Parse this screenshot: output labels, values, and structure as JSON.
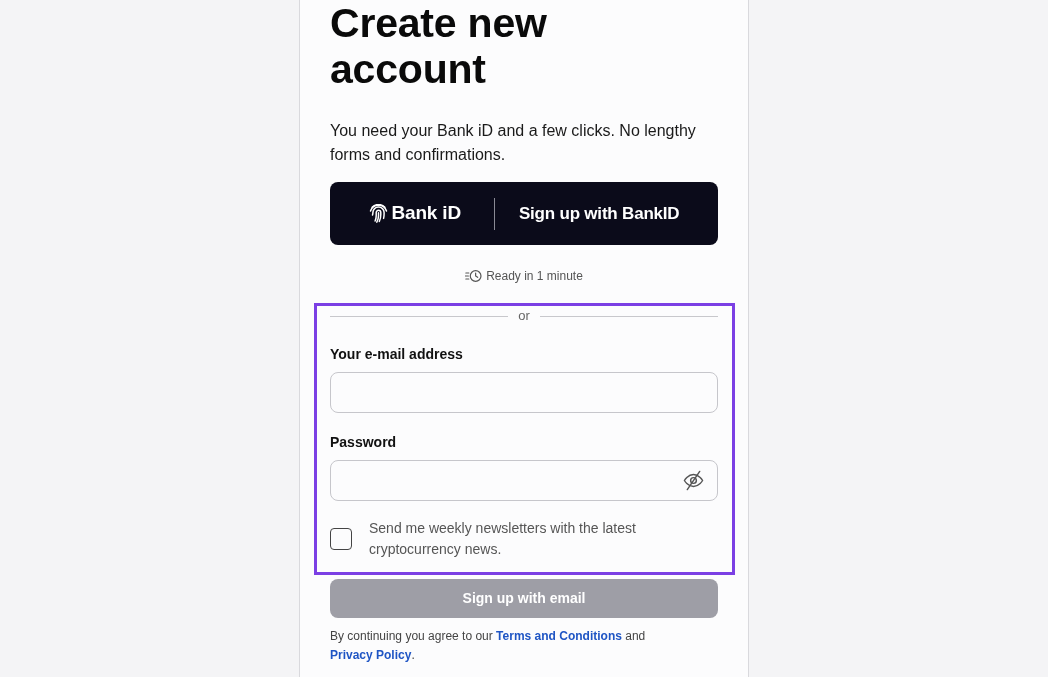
{
  "heading": "Create new account",
  "intro": "You need your Bank iD and a few clicks. No lengthy forms and confirmations.",
  "bankid_button": {
    "logo_text": "Bank iD",
    "label": "Sign up with BankID"
  },
  "ready_note": "Ready in 1 minute",
  "email_form": {
    "highlighted": true,
    "divider_text": "or",
    "fields": [
      {
        "kind": "email",
        "label": "Your e-mail address"
      },
      {
        "kind": "password",
        "label": "Password"
      }
    ],
    "newsletter": {
      "label": "Send me weekly newsletters with the latest cryptocurrency news.",
      "checked": false
    }
  },
  "submit_button": {
    "label": "Sign up with email",
    "disabled": true
  },
  "legal": [
    {
      "kind": "text",
      "text": "By continuing you agree to our "
    },
    {
      "kind": "link",
      "text": "Terms and Conditions"
    },
    {
      "kind": "text",
      "text": " and "
    },
    {
      "kind": "link",
      "text": "Privacy Policy"
    },
    {
      "kind": "text",
      "text": "."
    }
  ]
}
